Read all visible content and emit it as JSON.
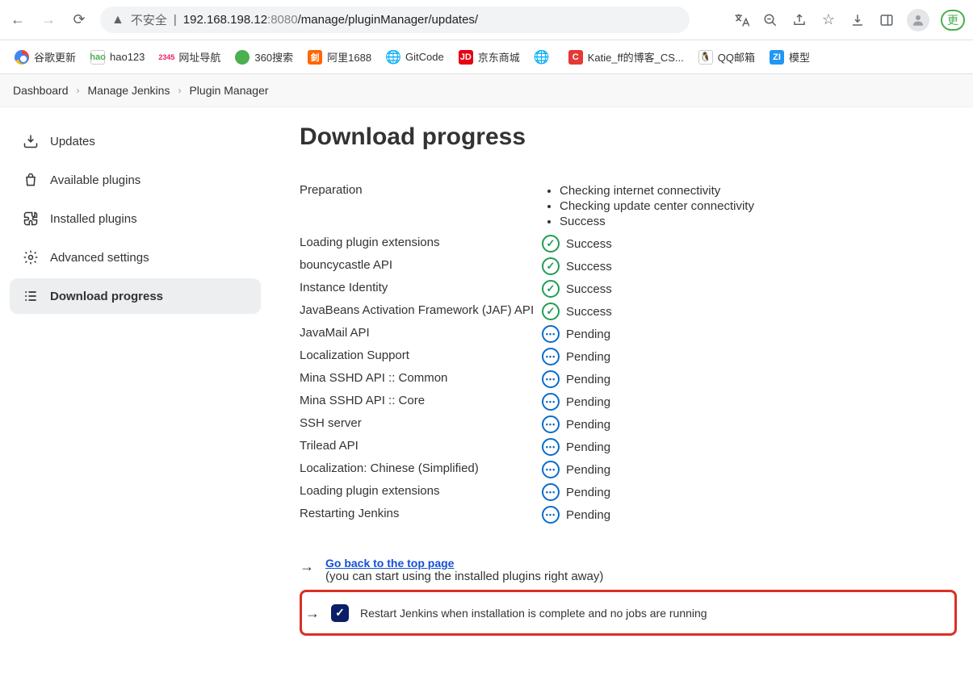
{
  "browser": {
    "not_secure": "不安全",
    "url_host": "192.168.198.12",
    "url_port": ":8080",
    "url_path": "/manage/pluginManager/updates/",
    "ext_label": "更"
  },
  "bookmarks": [
    {
      "label": "谷歌更新"
    },
    {
      "label": "hao123"
    },
    {
      "label": "网址导航"
    },
    {
      "label": "360搜索"
    },
    {
      "label": "阿里1688"
    },
    {
      "label": "GitCode"
    },
    {
      "label": "京东商城"
    },
    {
      "label": ""
    },
    {
      "label": "Katie_ff的博客_CS..."
    },
    {
      "label": "QQ邮箱"
    },
    {
      "label": "模型"
    }
  ],
  "breadcrumb": {
    "a": "Dashboard",
    "b": "Manage Jenkins",
    "c": "Plugin Manager"
  },
  "sidebar": {
    "items": [
      {
        "label": "Updates"
      },
      {
        "label": "Available plugins"
      },
      {
        "label": "Installed plugins"
      },
      {
        "label": "Advanced settings"
      },
      {
        "label": "Download progress"
      }
    ]
  },
  "page": {
    "title": "Download progress",
    "prep_label": "Preparation",
    "prep_items": [
      "Checking internet connectivity",
      "Checking update center connectivity",
      "Success"
    ],
    "status_success": "Success",
    "status_pending": "Pending",
    "rows": [
      {
        "name": "Loading plugin extensions",
        "status": "success"
      },
      {
        "name": "bouncycastle API",
        "status": "success"
      },
      {
        "name": "Instance Identity",
        "status": "success"
      },
      {
        "name": "JavaBeans Activation Framework (JAF) API",
        "status": "success"
      },
      {
        "name": "JavaMail API",
        "status": "pending"
      },
      {
        "name": "Localization Support",
        "status": "pending"
      },
      {
        "name": "Mina SSHD API :: Common",
        "status": "pending"
      },
      {
        "name": "Mina SSHD API :: Core",
        "status": "pending"
      },
      {
        "name": "SSH server",
        "status": "pending"
      },
      {
        "name": "Trilead API",
        "status": "pending"
      },
      {
        "name": "Localization: Chinese (Simplified)",
        "status": "pending"
      },
      {
        "name": "Loading plugin extensions",
        "status": "pending"
      },
      {
        "name": "Restarting Jenkins",
        "status": "pending"
      }
    ],
    "go_back": "Go back to the top page",
    "go_back_hint": "(you can start using the installed plugins right away)",
    "restart_label": "Restart Jenkins when installation is complete and no jobs are running"
  }
}
